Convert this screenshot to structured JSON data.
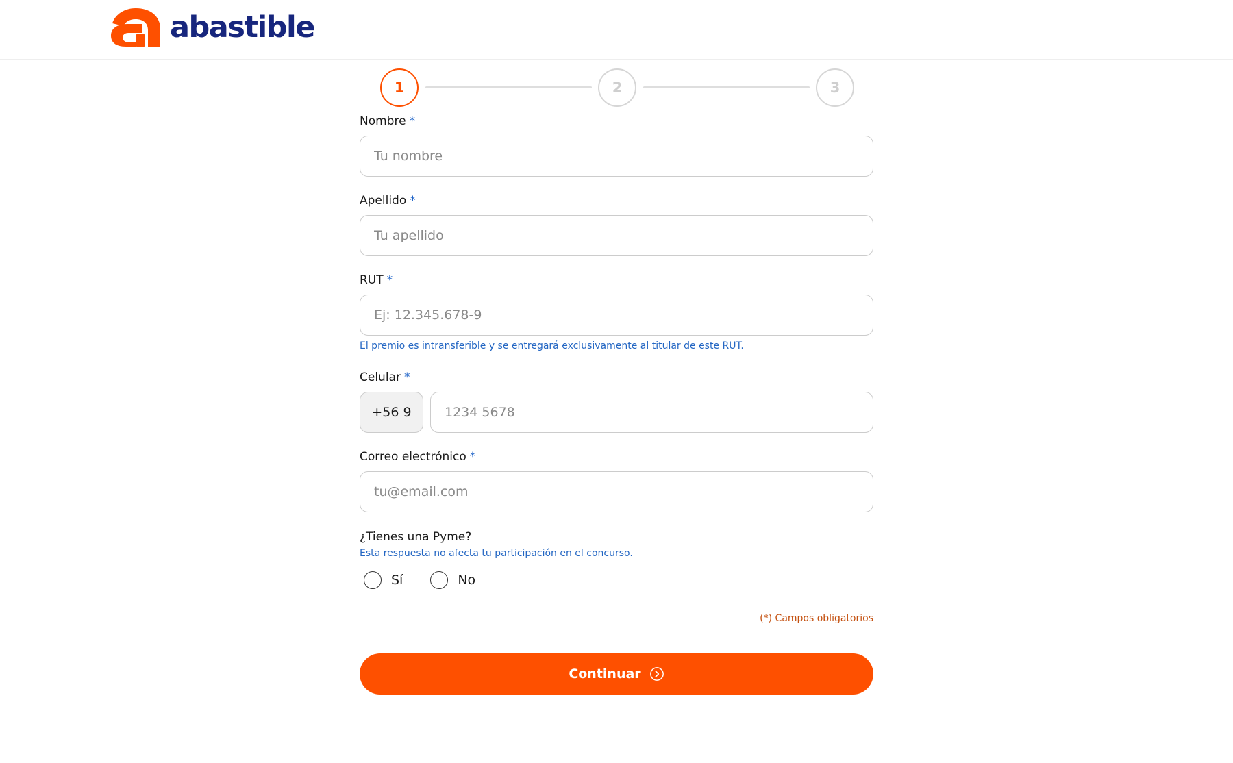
{
  "brand": {
    "name": "abastible",
    "colors": {
      "primary": "#fe5000",
      "navy": "#17267d",
      "hint": "#2366c3"
    }
  },
  "stepper": {
    "current": 1,
    "steps": [
      {
        "label": "1"
      },
      {
        "label": "2"
      },
      {
        "label": "3"
      }
    ]
  },
  "form": {
    "nombre": {
      "label": "Nombre",
      "required_mark": "*",
      "placeholder": "Tu nombre",
      "value": ""
    },
    "apellido": {
      "label": "Apellido",
      "required_mark": "*",
      "placeholder": "Tu apellido",
      "value": ""
    },
    "rut": {
      "label": "RUT",
      "required_mark": "*",
      "placeholder": "Ej: 12.345.678-9",
      "value": "",
      "hint": "El premio es intransferible y se entregará exclusivamente al titular de este RUT."
    },
    "celular": {
      "label": "Celular",
      "required_mark": "*",
      "prefix": "+56 9",
      "placeholder": "1234 5678",
      "value": ""
    },
    "correo": {
      "label": "Correo electrónico",
      "required_mark": "*",
      "placeholder": "tu@email.com",
      "value": ""
    },
    "pyme": {
      "question": "¿Tienes una Pyme?",
      "hint": "Esta respuesta no afecta tu participación en el concurso.",
      "options": [
        {
          "label": "Sí",
          "selected": false
        },
        {
          "label": "No",
          "selected": false
        }
      ]
    },
    "required_note": "(*) Campos obligatorios",
    "submit_label": "Continuar",
    "submit_icon": "chevron-right-circle-icon"
  }
}
